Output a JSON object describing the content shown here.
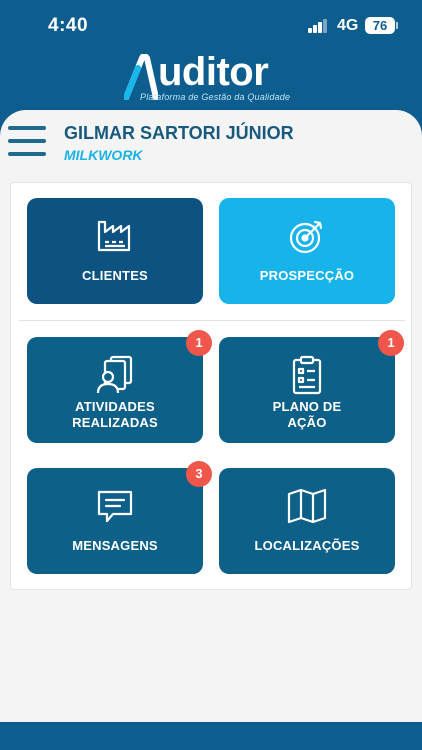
{
  "status_bar": {
    "time": "4:40",
    "network": "4G",
    "battery": "76"
  },
  "brand": {
    "name": "uditor",
    "tagline": "Plataforma de Gestão da Qualidade"
  },
  "header": {
    "user_name": "GILMAR SARTORI JÚNIOR",
    "company": "MILKWORK"
  },
  "tiles": [
    {
      "label": "CLIENTES",
      "icon": "factory-icon",
      "badge": null
    },
    {
      "label": "PROSPECÇÃO",
      "icon": "target-icon",
      "badge": null
    },
    {
      "label": "ATIVIDADES\nREALIZADAS",
      "icon": "user-documents-icon",
      "badge": "1"
    },
    {
      "label": "PLANO DE\nAÇÃO",
      "icon": "clipboard-checklist-icon",
      "badge": "1"
    },
    {
      "label": "MENSAGENS",
      "icon": "message-icon",
      "badge": "3"
    },
    {
      "label": "LOCALIZAÇÕES",
      "icon": "map-icon",
      "badge": null
    }
  ],
  "colors": {
    "primary": "#0d5e8e",
    "tile": "#0d6088",
    "accent": "#16b4ea",
    "badge": "#f0564a"
  }
}
